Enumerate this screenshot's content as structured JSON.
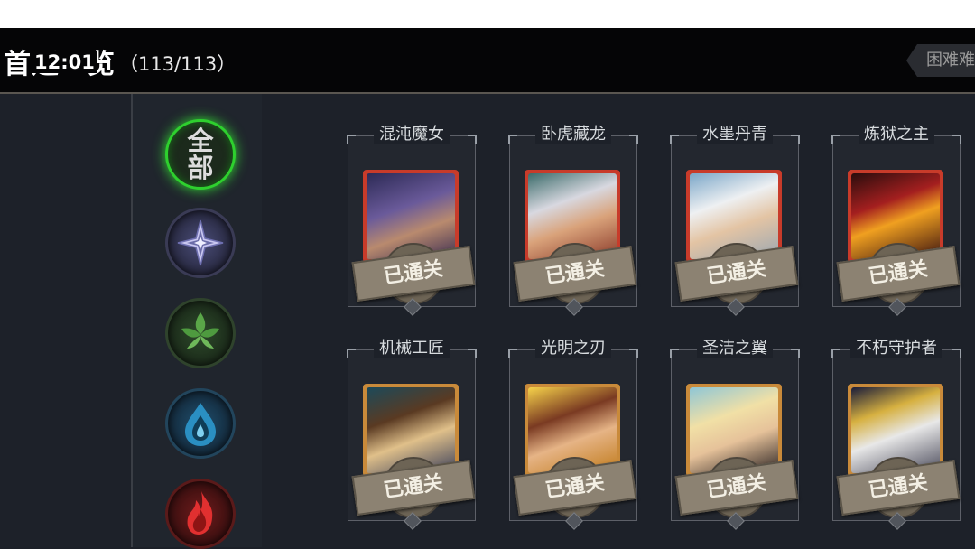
{
  "header": {
    "title": "首通一览",
    "count": "（113/113）",
    "clock": "12:01",
    "difficulty": "困难难"
  },
  "filters": [
    {
      "name": "all",
      "label": "全部",
      "selected": true
    },
    {
      "name": "star",
      "icon": "star-icon"
    },
    {
      "name": "leaf",
      "icon": "leaf-icon"
    },
    {
      "name": "water",
      "icon": "water-drop-icon"
    },
    {
      "name": "fire",
      "icon": "fire-icon"
    }
  ],
  "heroes": [
    {
      "name": "混沌魔女",
      "status": "已通关",
      "frame": "red"
    },
    {
      "name": "卧虎藏龙",
      "status": "已通关",
      "frame": "red"
    },
    {
      "name": "水墨丹青",
      "status": "已通关",
      "frame": "red"
    },
    {
      "name": "炼狱之主",
      "status": "已通关",
      "frame": "red"
    },
    {
      "name": "机械工匠",
      "status": "已通关",
      "frame": "gold"
    },
    {
      "name": "光明之刃",
      "status": "已通关",
      "frame": "gold"
    },
    {
      "name": "圣洁之翼",
      "status": "已通关",
      "frame": "gold"
    },
    {
      "name": "不朽守护者",
      "status": "已通关",
      "frame": "gold"
    }
  ],
  "colors": {
    "selected_glow": "#2ed02e",
    "frame_red": "#c83b2a",
    "frame_gold": "#c98a3a"
  }
}
